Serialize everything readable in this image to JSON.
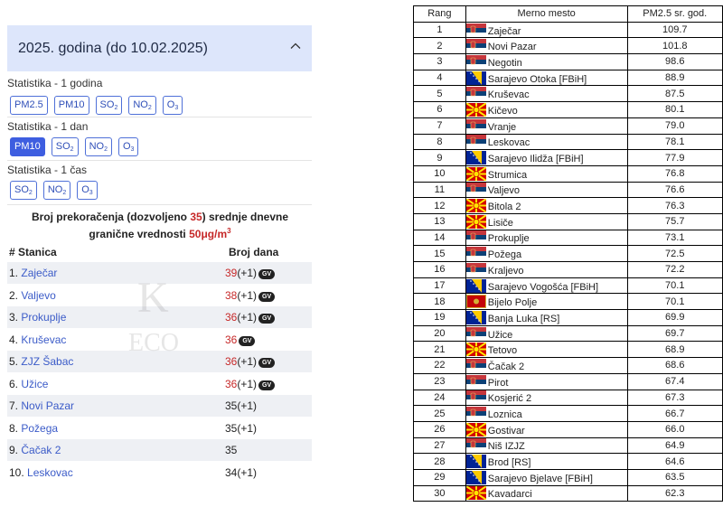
{
  "left": {
    "header_title": "2025. godina (do 10.02.2025)",
    "sections": [
      {
        "title": "Statistika - 1 godina",
        "buttons": [
          {
            "label": "PM2.5",
            "sub": "",
            "active": false
          },
          {
            "label": "PM10",
            "sub": "",
            "active": false
          },
          {
            "label": "SO",
            "sub": "2",
            "active": false
          },
          {
            "label": "NO",
            "sub": "2",
            "active": false
          },
          {
            "label": "O",
            "sub": "3",
            "active": false
          }
        ]
      },
      {
        "title": "Statistika - 1 dan",
        "buttons": [
          {
            "label": "PM10",
            "sub": "",
            "active": true
          },
          {
            "label": "SO",
            "sub": "2",
            "active": false
          },
          {
            "label": "NO",
            "sub": "2",
            "active": false
          },
          {
            "label": "O",
            "sub": "3",
            "active": false
          }
        ]
      },
      {
        "title": "Statistika - 1 čas",
        "buttons": [
          {
            "label": "SO",
            "sub": "2",
            "active": false
          },
          {
            "label": "NO",
            "sub": "2",
            "active": false
          },
          {
            "label": "O",
            "sub": "3",
            "active": false
          }
        ]
      }
    ],
    "note": {
      "part1": "Broj prekoračenja (dozvoljeno ",
      "allowed": "35",
      "part2": ") srednje dnevne granične vrednosti ",
      "limit": "50μg/m",
      "limit_sup": "3"
    },
    "table_header": {
      "station": "# Stanica",
      "days": "Broj dana"
    },
    "rows": [
      {
        "rank": "1.",
        "name": "Zaječar",
        "days": "39",
        "extra": "(+1)",
        "red": true,
        "gv": true
      },
      {
        "rank": "2.",
        "name": "Valjevo",
        "days": "38",
        "extra": "(+1)",
        "red": true,
        "gv": true
      },
      {
        "rank": "3.",
        "name": "Prokuplje",
        "days": "36",
        "extra": "(+1)",
        "red": true,
        "gv": true
      },
      {
        "rank": "4.",
        "name": "Kruševac",
        "days": "36",
        "extra": "",
        "red": true,
        "gv": true
      },
      {
        "rank": "5.",
        "name": "ZJZ Šabac",
        "days": "36",
        "extra": "(+1)",
        "red": true,
        "gv": true
      },
      {
        "rank": "6.",
        "name": "Užice",
        "days": "36",
        "extra": "(+1)",
        "red": true,
        "gv": true
      },
      {
        "rank": "7.",
        "name": "Novi Pazar",
        "days": "35",
        "extra": "(+1)",
        "red": false,
        "gv": false
      },
      {
        "rank": "8.",
        "name": "Požega",
        "days": "35",
        "extra": "(+1)",
        "red": false,
        "gv": false
      },
      {
        "rank": "9.",
        "name": "Čačak 2",
        "days": "35",
        "extra": "",
        "red": false,
        "gv": false
      },
      {
        "rank": "10.",
        "name": "Leskovac",
        "days": "34",
        "extra": "(+1)",
        "red": false,
        "gv": false
      }
    ],
    "gv_label": "GV",
    "watermark": [
      "K",
      "ECO"
    ],
    "colors": {
      "accent": "#3e5ee0",
      "red": "#c62828",
      "header_bg": "#dde6fb"
    }
  },
  "right": {
    "headers": {
      "rank": "Rang",
      "station": "Merno mesto",
      "value": "PM2.5 sr. god."
    },
    "rows": [
      {
        "rank": "1",
        "flag": "rs",
        "name": "Zaječar",
        "value": "109.7"
      },
      {
        "rank": "2",
        "flag": "rs",
        "name": "Novi Pazar",
        "value": "101.8"
      },
      {
        "rank": "3",
        "flag": "rs",
        "name": "Negotin",
        "value": "98.6"
      },
      {
        "rank": "4",
        "flag": "ba",
        "name": "Sarajevo Otoka [FBiH]",
        "value": "88.9"
      },
      {
        "rank": "5",
        "flag": "rs",
        "name": "Kruševac",
        "value": "87.5"
      },
      {
        "rank": "6",
        "flag": "mk",
        "name": "Kičevo",
        "value": "80.1"
      },
      {
        "rank": "7",
        "flag": "rs",
        "name": "Vranje",
        "value": "79.0"
      },
      {
        "rank": "8",
        "flag": "rs",
        "name": "Leskovac",
        "value": "78.1"
      },
      {
        "rank": "9",
        "flag": "ba",
        "name": "Sarajevo Ilidža [FBiH]",
        "value": "77.9"
      },
      {
        "rank": "10",
        "flag": "mk",
        "name": "Strumica",
        "value": "76.8"
      },
      {
        "rank": "11",
        "flag": "rs",
        "name": "Valjevo",
        "value": "76.6"
      },
      {
        "rank": "12",
        "flag": "mk",
        "name": "Bitola 2",
        "value": "76.3"
      },
      {
        "rank": "13",
        "flag": "mk",
        "name": "Lisiče",
        "value": "75.7"
      },
      {
        "rank": "14",
        "flag": "rs",
        "name": "Prokuplje",
        "value": "73.1"
      },
      {
        "rank": "15",
        "flag": "rs",
        "name": "Požega",
        "value": "72.5"
      },
      {
        "rank": "16",
        "flag": "rs",
        "name": "Kraljevo",
        "value": "72.2"
      },
      {
        "rank": "17",
        "flag": "ba",
        "name": "Sarajevo Vogošća [FBiH]",
        "value": "70.1"
      },
      {
        "rank": "18",
        "flag": "me",
        "name": "Bijelo Polje",
        "value": "70.1"
      },
      {
        "rank": "19",
        "flag": "ba",
        "name": "Banja Luka [RS]",
        "value": "69.9"
      },
      {
        "rank": "20",
        "flag": "rs",
        "name": "Užice",
        "value": "69.7"
      },
      {
        "rank": "21",
        "flag": "mk",
        "name": "Tetovo",
        "value": "68.9"
      },
      {
        "rank": "22",
        "flag": "rs",
        "name": "Čačak 2",
        "value": "68.6"
      },
      {
        "rank": "23",
        "flag": "rs",
        "name": "Pirot",
        "value": "67.4"
      },
      {
        "rank": "24",
        "flag": "rs",
        "name": "Kosjerić 2",
        "value": "67.3"
      },
      {
        "rank": "25",
        "flag": "rs",
        "name": "Loznica",
        "value": "66.7"
      },
      {
        "rank": "26",
        "flag": "mk",
        "name": "Gostivar",
        "value": "66.0"
      },
      {
        "rank": "27",
        "flag": "rs",
        "name": "Niš IZJZ",
        "value": "64.9"
      },
      {
        "rank": "28",
        "flag": "ba",
        "name": "Brod [RS]",
        "value": "64.6"
      },
      {
        "rank": "29",
        "flag": "ba",
        "name": "Sarajevo Bjelave [FBiH]",
        "value": "63.5"
      },
      {
        "rank": "30",
        "flag": "mk",
        "name": "Kavadarci",
        "value": "62.3"
      }
    ]
  }
}
